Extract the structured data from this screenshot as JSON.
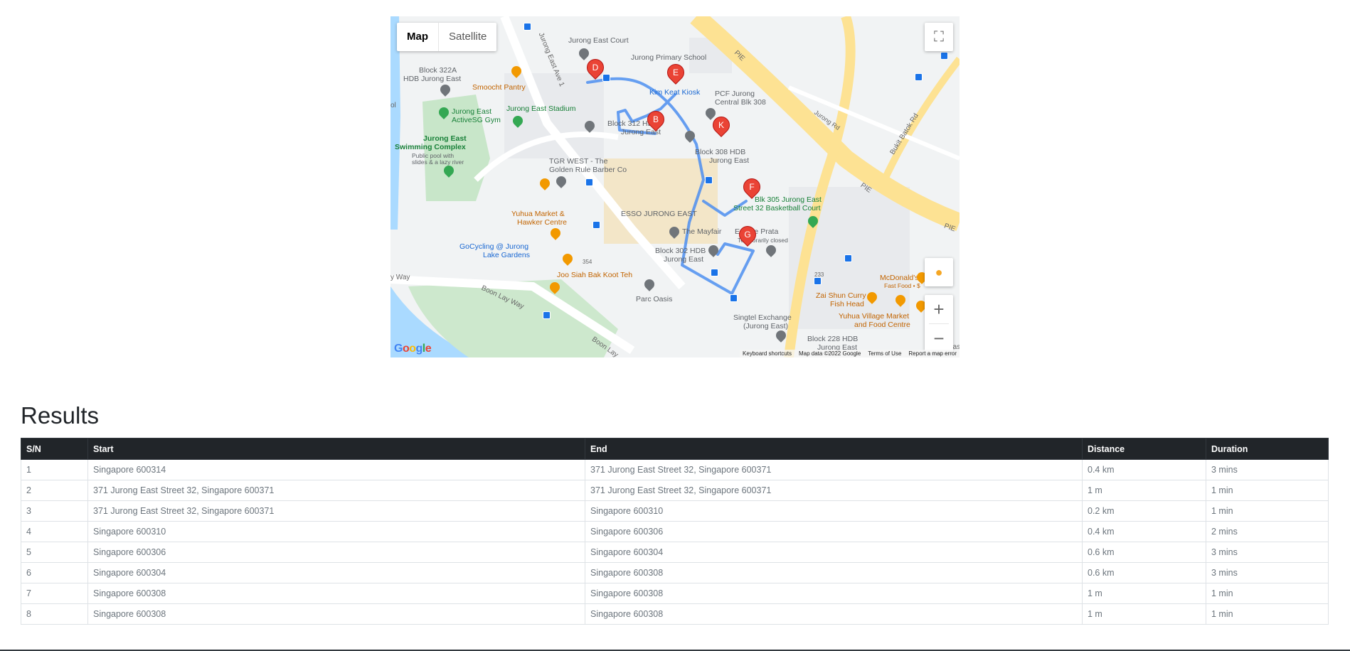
{
  "map": {
    "type_control": {
      "map_label": "Map",
      "satellite_label": "Satellite"
    },
    "zoom": {
      "in_label": "+",
      "out_label": "−"
    },
    "google_logo": "Google",
    "attribution": {
      "shortcuts": "Keyboard shortcuts",
      "data": "Map data ©2022 Google",
      "terms": "Terms of Use",
      "report": "Report a map error"
    },
    "markers": [
      "D",
      "E",
      "B",
      "K",
      "F",
      "G"
    ],
    "labels": {
      "jurong_east_court": "Jurong East Court",
      "jurong_primary": "Jurong Primary School",
      "block_322a": "Block 322A",
      "hdb_jurong_east": "HDB Jurong East",
      "smoocht": "Smoocht Pantry",
      "kim_keat": "Kim Keat Kiosk",
      "pcf": "PCF Jurong",
      "central": "Central Blk 308",
      "activesg": "Jurong East",
      "activesg2": "ActiveSG Gym",
      "stadium": "Jurong East Stadium",
      "block312": "Block 312 HDB",
      "block312b": "Jurong East",
      "pool": "Jurong East",
      "pool2": "Swimming Complex",
      "pool3": "Public pool with",
      "pool4": "slides & a lazy river",
      "block308": "Block 308 HDB",
      "block308b": "Jurong East",
      "tgr": "TGR WEST - The",
      "tgr2": "Golden Rule Barber Co",
      "blk305": "Blk 305 Jurong East",
      "blk305b": "Street 32 Basketball Court",
      "yuhua": "Yuhua Market &",
      "yuhua2": "Hawker Centre",
      "esso": "ESSO JURONG EAST",
      "mayfair": "The Mayfair",
      "prata": "Eat the Prata",
      "prata2": "Temporarily closed",
      "gocycling": "GoCycling @ Jurong",
      "gocycling2": "Lake Gardens",
      "block302": "Block 302 HDB",
      "block302b": "Jurong East",
      "joo": "Joo Siah Bak Koot Teh",
      "parc": "Parc Oasis",
      "mcd": "McDonald's -",
      "mcd2": "Fast Food • $",
      "zai": "Zai Shun Curry",
      "zai2": "Fish Head",
      "yuhua_village": "Yuhua Village Market",
      "yuhua_village2": "and Food Centre",
      "singtel": "Singtel Exchange",
      "singtel2": "(Jurong East)",
      "block228": "Block 228 HDB",
      "block228b": "Jurong East",
      "pie1": "PIE",
      "pie2": "PIE",
      "pie3": "PIE",
      "jurong_rd": "Jurong Rd",
      "bukit": "Bukit Batok Rd",
      "jurong_east_ave": "Jurong East Ave 1",
      "boon_lay": "Boon Lay Way",
      "boon_lay2": "Boon Lay",
      "lay_way": "y Way",
      "n354": "354",
      "n233": "233",
      "ol": "ol",
      "eas": "Eas"
    }
  },
  "results": {
    "title": "Results",
    "columns": [
      "S/N",
      "Start",
      "End",
      "Distance",
      "Duration"
    ],
    "rows": [
      [
        "1",
        "Singapore 600314",
        "371 Jurong East Street 32, Singapore 600371",
        "0.4 km",
        "3 mins"
      ],
      [
        "2",
        "371 Jurong East Street 32, Singapore 600371",
        "371 Jurong East Street 32, Singapore 600371",
        "1 m",
        "1 min"
      ],
      [
        "3",
        "371 Jurong East Street 32, Singapore 600371",
        "Singapore 600310",
        "0.2 km",
        "1 min"
      ],
      [
        "4",
        "Singapore 600310",
        "Singapore 600306",
        "0.4 km",
        "2 mins"
      ],
      [
        "5",
        "Singapore 600306",
        "Singapore 600304",
        "0.6 km",
        "3 mins"
      ],
      [
        "6",
        "Singapore 600304",
        "Singapore 600308",
        "0.6 km",
        "3 mins"
      ],
      [
        "7",
        "Singapore 600308",
        "Singapore 600308",
        "1 m",
        "1 min"
      ],
      [
        "8",
        "Singapore 600308",
        "Singapore 600308",
        "1 m",
        "1 min"
      ]
    ]
  }
}
